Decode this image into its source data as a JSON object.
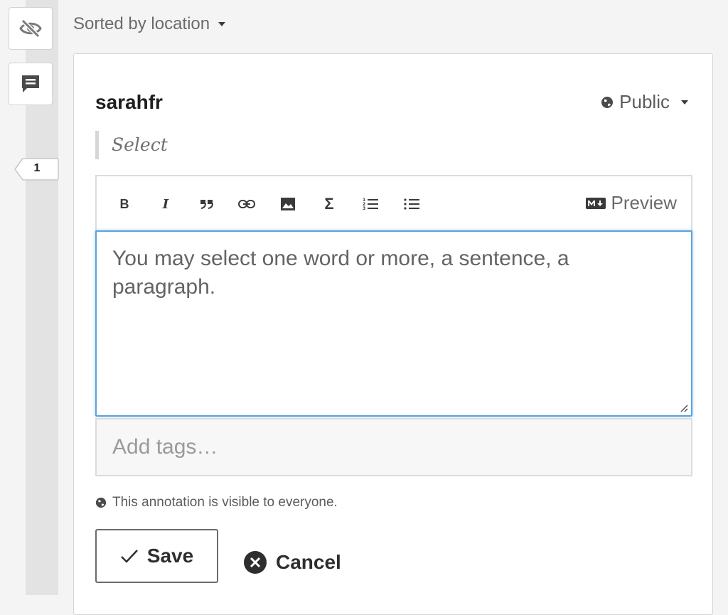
{
  "sidebar": {
    "annotation_count": "1"
  },
  "sort": {
    "label": "Sorted by location"
  },
  "annotation": {
    "username": "sarahfr",
    "privacy_label": "Public",
    "quote": "Select",
    "editor": {
      "preview_label": "Preview",
      "body_text": "You may select one word or more, a sentence, a paragraph.",
      "tools": [
        {
          "name": "bold",
          "label": "B"
        },
        {
          "name": "italic",
          "label": "I"
        },
        {
          "name": "quote",
          "label": "”"
        },
        {
          "name": "link",
          "label": "link"
        },
        {
          "name": "image",
          "label": "image"
        },
        {
          "name": "math",
          "label": "Σ"
        },
        {
          "name": "numbered-list",
          "label": "ol"
        },
        {
          "name": "bulleted-list",
          "label": "ul"
        }
      ]
    },
    "tags_placeholder": "Add tags…",
    "visibility_note": "This annotation is visible to everyone.",
    "save_label": "Save",
    "cancel_label": "Cancel"
  },
  "colors": {
    "focus_border": "#5aa3e0",
    "rail": "#e3e3e3"
  }
}
